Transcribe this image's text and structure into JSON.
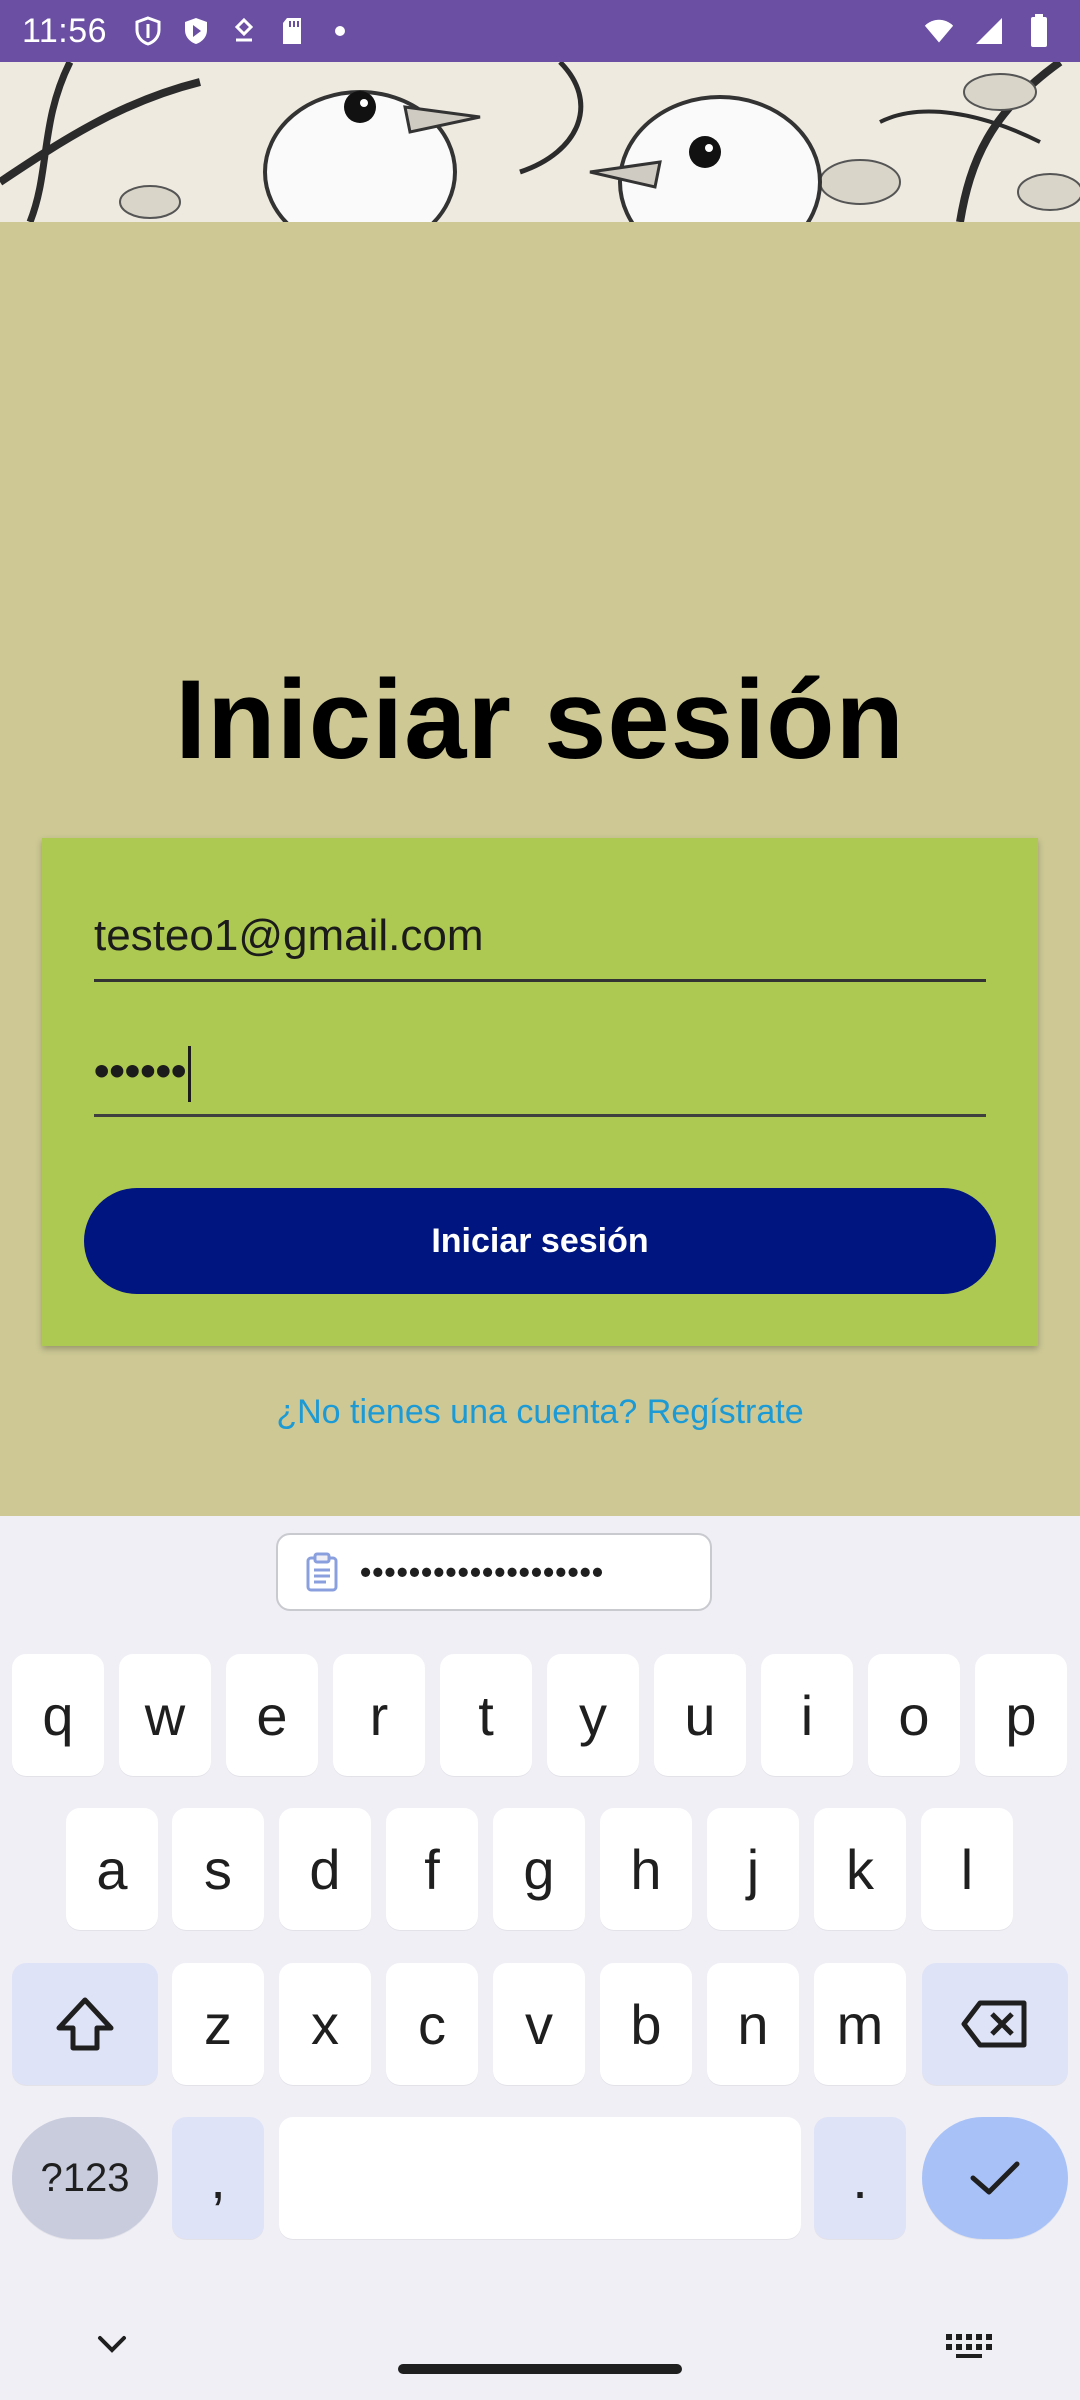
{
  "status_bar": {
    "time": "11:56",
    "left_icons": [
      "shield-icon",
      "play-icon",
      "download-icon",
      "sd-card-icon",
      "dot-icon"
    ],
    "right_icons": [
      "wifi-icon",
      "signal-icon",
      "battery-icon"
    ]
  },
  "login": {
    "title": "Iniciar sesión",
    "email_value": "testeo1@gmail.com",
    "password_value": "••••••",
    "submit_label": "Iniciar sesión",
    "register_link": "¿No tienes una cuenta? Regístrate"
  },
  "keyboard": {
    "suggestion": "••••••••••••••••••••",
    "row1": [
      "q",
      "w",
      "e",
      "r",
      "t",
      "y",
      "u",
      "i",
      "o",
      "p"
    ],
    "row2": [
      "a",
      "s",
      "d",
      "f",
      "g",
      "h",
      "j",
      "k",
      "l"
    ],
    "row3": [
      "z",
      "x",
      "c",
      "v",
      "b",
      "n",
      "m"
    ],
    "numbers_key": "?123",
    "comma_key": ",",
    "period_key": "."
  },
  "colors": {
    "status_bar": "#6a4fa3",
    "background": "#cdc894",
    "card": "#aec952",
    "button": "#00157f",
    "link": "#1c9ad6"
  }
}
